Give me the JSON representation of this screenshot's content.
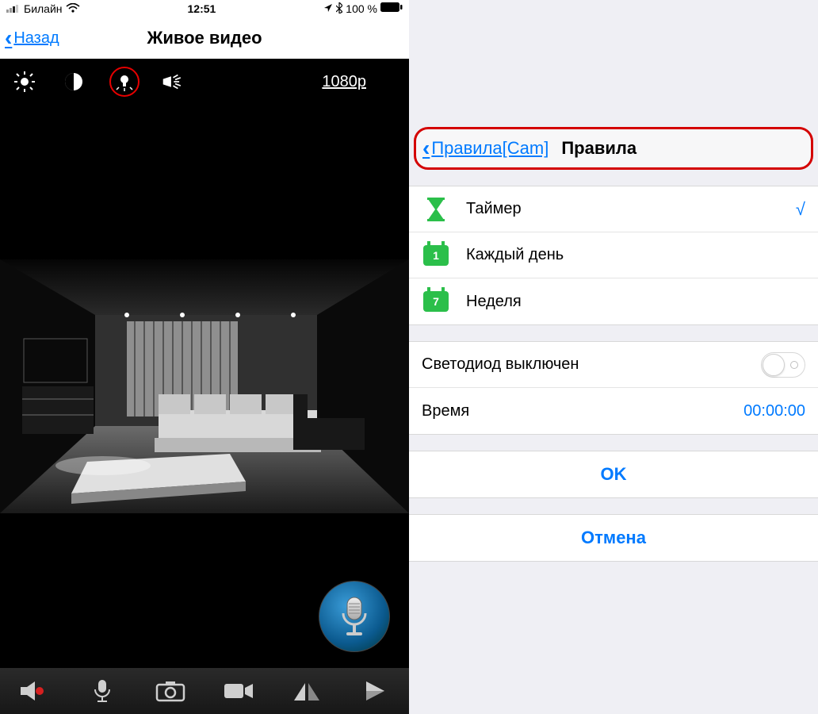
{
  "status": {
    "carrier": "Билайн",
    "time": "12:51",
    "battery": "100 %"
  },
  "left": {
    "back": "Назад",
    "title": "Живое видео",
    "resolution": "1080p"
  },
  "right": {
    "back": "Правила[Cam]",
    "title": "Правила",
    "options": {
      "timer": "Таймер",
      "daily": "Каждый день",
      "weekly": "Неделя",
      "daily_badge": "1",
      "weekly_badge": "7",
      "check": "√"
    },
    "led_off_label": "Светодиод выключен",
    "time_label": "Время",
    "time_value": "00:00:00",
    "ok": "OK",
    "cancel": "Отмена"
  }
}
